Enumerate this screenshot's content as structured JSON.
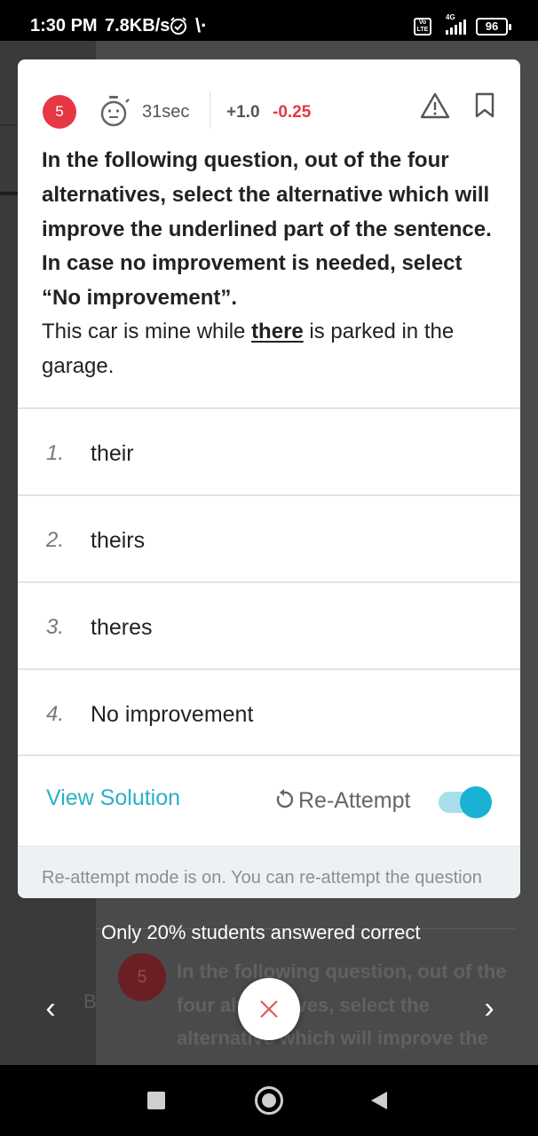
{
  "status_bar": {
    "time": "1:30 PM",
    "speed": "7.8KB/s",
    "volte": "Vo LTE",
    "network": "4G",
    "battery": "96"
  },
  "question": {
    "number": "5",
    "timer": "31sec",
    "marks_positive": "+1.0",
    "marks_negative": "-0.25",
    "instruction": "In the following question, out of the four alternatives, select the alternative which will improve the underlined part of the sentence. In case no improvement is needed, select “No improvement”.",
    "sentence_before": "This car is mine while ",
    "sentence_underlined": "there",
    "sentence_after": " is parked in the garage."
  },
  "options": [
    {
      "num": "1.",
      "text": "their"
    },
    {
      "num": "2.",
      "text": "theirs"
    },
    {
      "num": "3.",
      "text": "theres"
    },
    {
      "num": "4.",
      "text": "No improvement"
    }
  ],
  "actions": {
    "view_solution": "View Solution",
    "reattempt": "Re-Attempt",
    "reattempt_enabled": true
  },
  "notice": "Re-attempt mode is on. You can re-attempt the question",
  "background": {
    "stats": "Only 20% students answered correct",
    "q_number": "5",
    "q_preview": "In the following question, out of the four alternatives, select the alternative which will improve the",
    "side_letter": "B"
  },
  "colors": {
    "accent": "#1ab2d4",
    "badge": "#e53844",
    "negative": "#e53844"
  },
  "icons": [
    "stopwatch-icon",
    "warning-icon",
    "bookmark-icon",
    "refresh-icon",
    "close-icon",
    "chevron-left-icon",
    "chevron-right-icon"
  ]
}
